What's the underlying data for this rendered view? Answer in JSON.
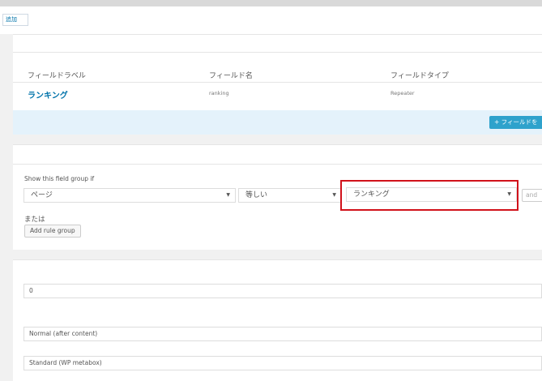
{
  "add_button_label": "追加",
  "table": {
    "headers": [
      "フィールドラベル",
      "フィールド名",
      "フィールドタイプ"
    ],
    "row": {
      "label": "ランキング",
      "name": "ranking",
      "type": "Repeater"
    }
  },
  "add_field_button_label": "+ フィールドを",
  "location": {
    "title": "Show this field group if",
    "param_value": "ページ",
    "operator_value": "等しい",
    "value_value": "ランキング",
    "and_label": "and",
    "or_label": "または",
    "add_rule_group_label": "Add rule group"
  },
  "settings": {
    "order_value": "0",
    "position_value": "Normal (after content)",
    "style_value": "Standard (WP metabox)"
  },
  "colors": {
    "link": "#0073aa",
    "primary_button": "#2ea2cc",
    "highlight_border": "#d1121b",
    "info_bar": "#e4f2fb"
  }
}
